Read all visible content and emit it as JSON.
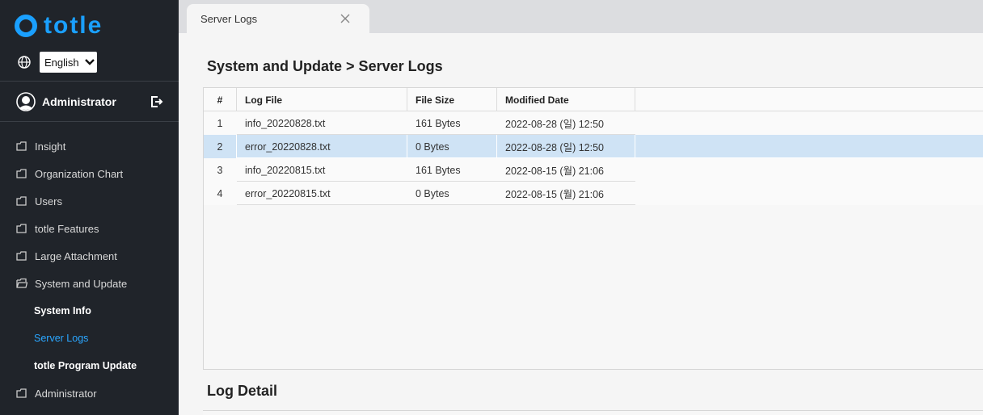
{
  "brand": {
    "name": "totle",
    "accent": "#1aa0ff"
  },
  "language": {
    "selected": "English"
  },
  "user": {
    "name": "Administrator"
  },
  "sidebar": {
    "items": [
      {
        "label": "Insight",
        "icon": "folder-icon"
      },
      {
        "label": "Organization Chart",
        "icon": "folder-icon"
      },
      {
        "label": "Users",
        "icon": "folder-icon"
      },
      {
        "label": "totle Features",
        "icon": "folder-icon"
      },
      {
        "label": "Large Attachment",
        "icon": "folder-icon"
      },
      {
        "label": "System and Update",
        "icon": "folder-open-icon"
      }
    ],
    "subitems": [
      {
        "label": "System Info",
        "active": false
      },
      {
        "label": "Server Logs",
        "active": true
      },
      {
        "label": "totle Program Update",
        "active": false
      }
    ],
    "last_item": {
      "label": "Administrator",
      "icon": "folder-icon"
    }
  },
  "tabs": [
    {
      "label": "Server Logs"
    }
  ],
  "page": {
    "title": "System and Update > Server Logs",
    "detail_title": "Log Detail"
  },
  "table": {
    "headers": {
      "num": "#",
      "file": "Log File",
      "size": "File Size",
      "date": "Modified Date"
    },
    "rows": [
      {
        "num": "1",
        "file": "info_20220828.txt",
        "size": "161 Bytes",
        "date": "2022-08-28 (일) 12:50",
        "selected": false
      },
      {
        "num": "2",
        "file": "error_20220828.txt",
        "size": "0 Bytes",
        "date": "2022-08-28 (일) 12:50",
        "selected": true
      },
      {
        "num": "3",
        "file": "info_20220815.txt",
        "size": "161 Bytes",
        "date": "2022-08-15 (월) 21:06",
        "selected": false
      },
      {
        "num": "4",
        "file": "error_20220815.txt",
        "size": "0 Bytes",
        "date": "2022-08-15 (월) 21:06",
        "selected": false
      }
    ]
  }
}
